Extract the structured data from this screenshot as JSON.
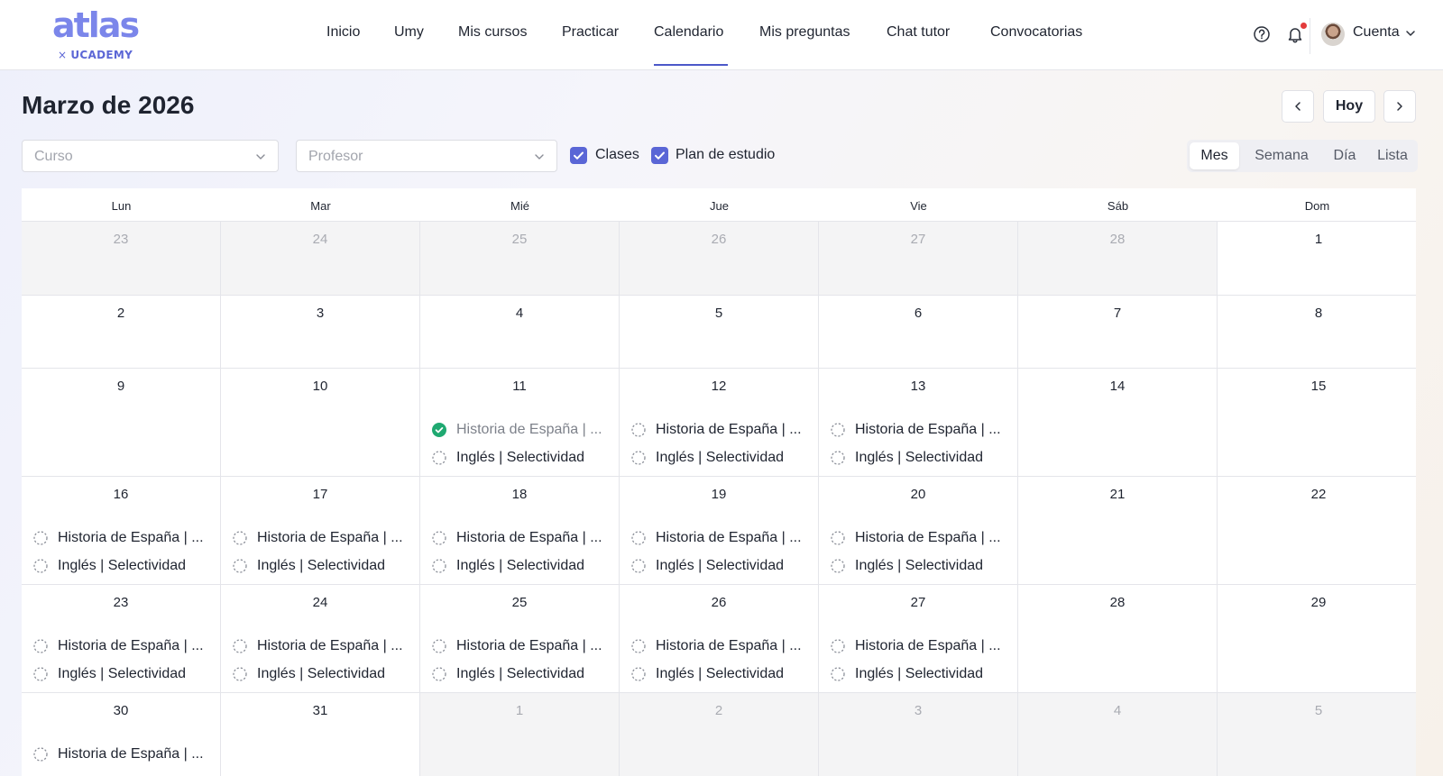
{
  "logo": {
    "word": "atlas",
    "sub_x": "×",
    "sub_brand": "UCADEMY"
  },
  "nav": {
    "items": [
      "Inicio",
      "Umy",
      "Mis cursos",
      "Practicar",
      "Calendario",
      "Mis preguntas",
      "Chat tutor",
      "Convocatorias"
    ],
    "active": "Calendario"
  },
  "header": {
    "help_icon": "question-circle-icon",
    "bell_icon": "bell-icon",
    "account_label": "Cuenta"
  },
  "calendar": {
    "title": "Marzo de 2026",
    "today_label": "Hoy",
    "filters": {
      "course_placeholder": "Curso",
      "teacher_placeholder": "Profesor"
    },
    "toggles": [
      {
        "label": "Clases",
        "checked": true
      },
      {
        "label": "Plan de estudio",
        "checked": true
      }
    ],
    "views": [
      "Mes",
      "Semana",
      "Día",
      "Lista"
    ],
    "active_view": "Mes",
    "weekdays": [
      "Lun",
      "Mar",
      "Mié",
      "Jue",
      "Vie",
      "Sáb",
      "Dom"
    ],
    "weeks": [
      [
        {
          "day": "23",
          "other": true,
          "events": []
        },
        {
          "day": "24",
          "other": true,
          "events": []
        },
        {
          "day": "25",
          "other": true,
          "events": []
        },
        {
          "day": "26",
          "other": true,
          "events": []
        },
        {
          "day": "27",
          "other": true,
          "events": []
        },
        {
          "day": "28",
          "other": true,
          "events": []
        },
        {
          "day": "1",
          "other": false,
          "events": []
        }
      ],
      [
        {
          "day": "2",
          "other": false,
          "events": []
        },
        {
          "day": "3",
          "other": false,
          "events": []
        },
        {
          "day": "4",
          "other": false,
          "events": []
        },
        {
          "day": "5",
          "other": false,
          "events": []
        },
        {
          "day": "6",
          "other": false,
          "events": []
        },
        {
          "day": "7",
          "other": false,
          "events": []
        },
        {
          "day": "8",
          "other": false,
          "events": []
        }
      ],
      [
        {
          "day": "9",
          "other": false,
          "events": []
        },
        {
          "day": "10",
          "other": false,
          "events": []
        },
        {
          "day": "11",
          "other": false,
          "events": [
            {
              "title": "Historia de España | ...",
              "done": true
            },
            {
              "title": "Inglés | Selectividad",
              "done": false
            }
          ]
        },
        {
          "day": "12",
          "other": false,
          "events": [
            {
              "title": "Historia de España | ...",
              "done": false
            },
            {
              "title": "Inglés | Selectividad",
              "done": false
            }
          ]
        },
        {
          "day": "13",
          "other": false,
          "events": [
            {
              "title": "Historia de España | ...",
              "done": false
            },
            {
              "title": "Inglés | Selectividad",
              "done": false
            }
          ]
        },
        {
          "day": "14",
          "other": false,
          "events": []
        },
        {
          "day": "15",
          "other": false,
          "events": []
        }
      ],
      [
        {
          "day": "16",
          "other": false,
          "events": [
            {
              "title": "Historia de España | ...",
              "done": false
            },
            {
              "title": "Inglés | Selectividad",
              "done": false
            }
          ]
        },
        {
          "day": "17",
          "other": false,
          "events": [
            {
              "title": "Historia de España | ...",
              "done": false
            },
            {
              "title": "Inglés | Selectividad",
              "done": false
            }
          ]
        },
        {
          "day": "18",
          "other": false,
          "events": [
            {
              "title": "Historia de España | ...",
              "done": false
            },
            {
              "title": "Inglés | Selectividad",
              "done": false
            }
          ]
        },
        {
          "day": "19",
          "other": false,
          "events": [
            {
              "title": "Historia de España | ...",
              "done": false
            },
            {
              "title": "Inglés | Selectividad",
              "done": false
            }
          ]
        },
        {
          "day": "20",
          "other": false,
          "events": [
            {
              "title": "Historia de España | ...",
              "done": false
            },
            {
              "title": "Inglés | Selectividad",
              "done": false
            }
          ]
        },
        {
          "day": "21",
          "other": false,
          "events": []
        },
        {
          "day": "22",
          "other": false,
          "events": []
        }
      ],
      [
        {
          "day": "23",
          "other": false,
          "events": [
            {
              "title": "Historia de España | ...",
              "done": false
            },
            {
              "title": "Inglés | Selectividad",
              "done": false
            }
          ]
        },
        {
          "day": "24",
          "other": false,
          "events": [
            {
              "title": "Historia de España | ...",
              "done": false
            },
            {
              "title": "Inglés | Selectividad",
              "done": false
            }
          ]
        },
        {
          "day": "25",
          "other": false,
          "events": [
            {
              "title": "Historia de España | ...",
              "done": false
            },
            {
              "title": "Inglés | Selectividad",
              "done": false
            }
          ]
        },
        {
          "day": "26",
          "other": false,
          "events": [
            {
              "title": "Historia de España | ...",
              "done": false
            },
            {
              "title": "Inglés | Selectividad",
              "done": false
            }
          ]
        },
        {
          "day": "27",
          "other": false,
          "events": [
            {
              "title": "Historia de España | ...",
              "done": false
            },
            {
              "title": "Inglés | Selectividad",
              "done": false
            }
          ]
        },
        {
          "day": "28",
          "other": false,
          "events": []
        },
        {
          "day": "29",
          "other": false,
          "events": []
        }
      ],
      [
        {
          "day": "30",
          "other": false,
          "events": [
            {
              "title": "Historia de España | ...",
              "done": false
            }
          ]
        },
        {
          "day": "31",
          "other": false,
          "events": []
        },
        {
          "day": "1",
          "other": true,
          "events": []
        },
        {
          "day": "2",
          "other": true,
          "events": []
        },
        {
          "day": "3",
          "other": true,
          "events": []
        },
        {
          "day": "4",
          "other": true,
          "events": []
        },
        {
          "day": "5",
          "other": true,
          "events": []
        }
      ]
    ]
  },
  "colors": {
    "accent": "#5a66d6",
    "done": "#1fa971",
    "logo": "#7b86ea"
  }
}
